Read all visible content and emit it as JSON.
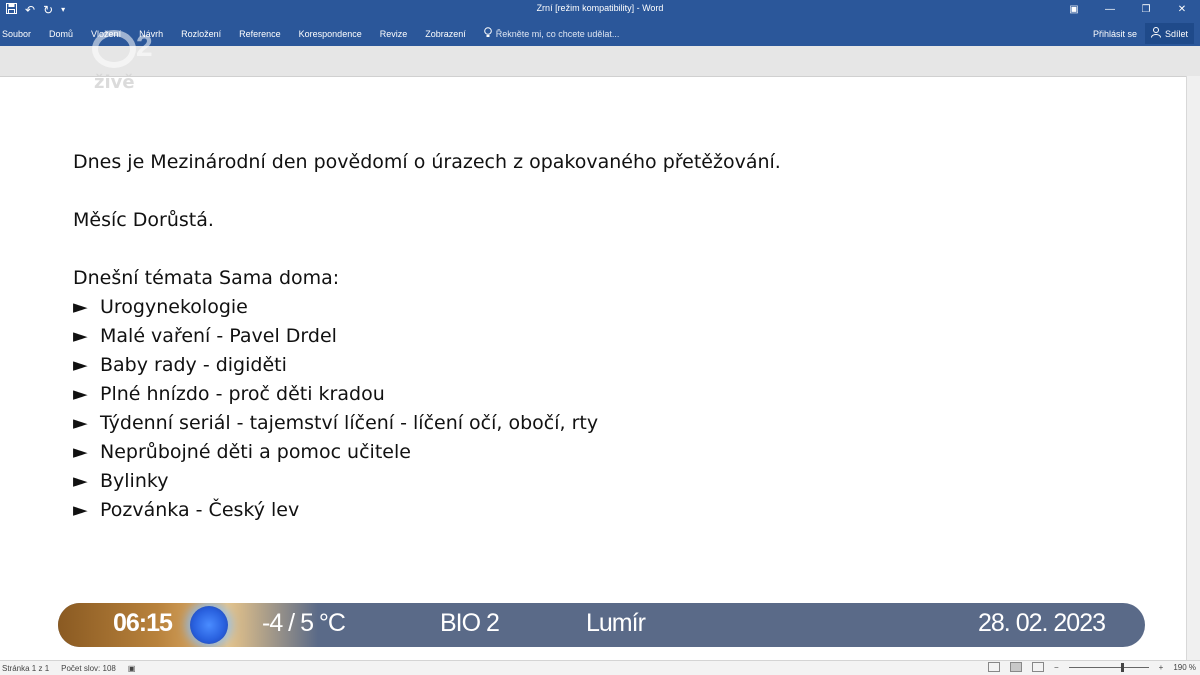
{
  "window": {
    "title": "Zrní [režim kompatibility] - Word",
    "quick_access": [
      "save-icon",
      "undo-icon",
      "redo-icon",
      "customize-icon"
    ]
  },
  "ribbon": {
    "tabs": [
      "Soubor",
      "Domů",
      "Vložení",
      "Návrh",
      "Rozložení",
      "Reference",
      "Korespondence",
      "Revize",
      "Zobrazení"
    ],
    "tell_me_placeholder": "Řekněte mi, co chcete udělat...",
    "signin_label": "Přihlásit se",
    "share_label": "Sdílet"
  },
  "watermark": {
    "number": "2",
    "word": "živě"
  },
  "document": {
    "line1": "Dnes je Mezinárodní den povědomí o úrazech z opakovaného přetěžování.",
    "line2": "Měsíc Dorůstá.",
    "topics_heading": "Dnešní témata Sama doma:",
    "bullet_mark": "►",
    "topics": [
      "Urogynekologie",
      "Malé vaření - Pavel Drdel",
      "Baby rady - digiděti",
      "Plné hnízdo - proč děti kradou",
      "Týdenní seriál - tajemství líčení - líčení očí, obočí, rty",
      "Neprůbojné děti a pomoc učitele",
      "Bylinky",
      "Pozvánka - Český lev"
    ]
  },
  "ticker": {
    "time": "06:15",
    "temperature": "-4 / 5 °C",
    "channel": "BIO 2",
    "nameday": "Lumír",
    "date": "28. 02. 2023"
  },
  "status_bar": {
    "page": "Stránka 1 z 1",
    "words": "Počet slov: 108",
    "zoom": "190 %"
  },
  "colors": {
    "ribbon": "#2b579a",
    "ticker": "#5a6a88",
    "ticker_time": "#b8823c"
  }
}
